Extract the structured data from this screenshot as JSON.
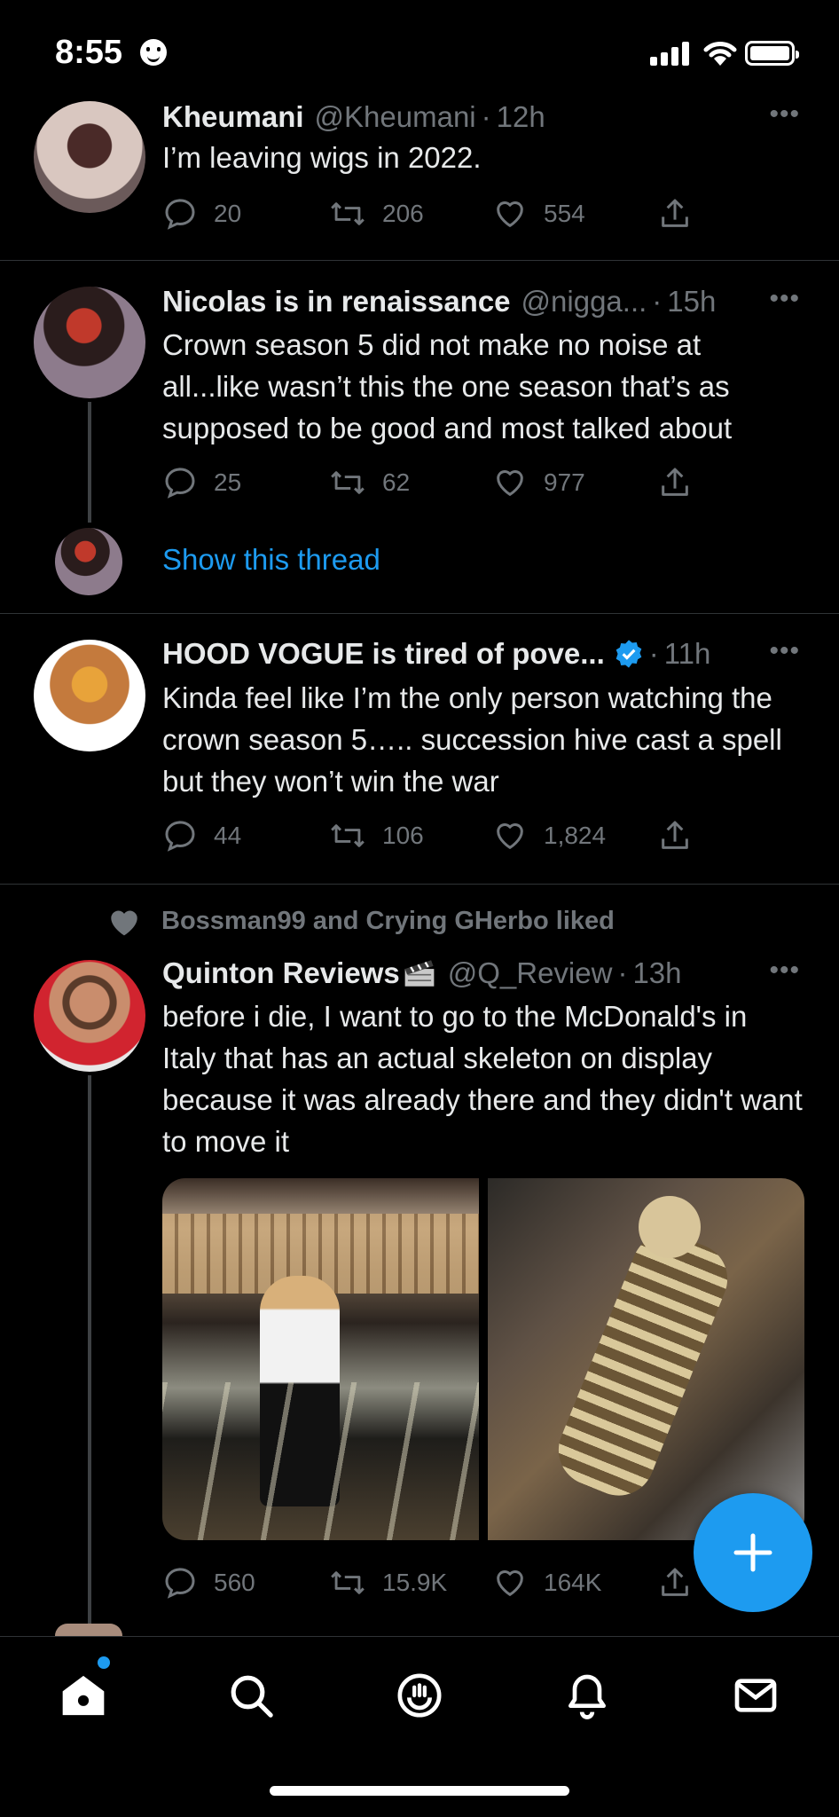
{
  "status": {
    "time": "8:55"
  },
  "tweets": [
    {
      "name": "Kheumani",
      "handle": "@Kheumani",
      "time": "12h",
      "text": "I’m leaving wigs in 2022.",
      "replies": "20",
      "retweets": "206",
      "likes": "554"
    },
    {
      "name": "Nicolas is in renaissance",
      "handle": "@nigga...",
      "time": "15h",
      "text": "Crown season 5 did not make no noise at all...like wasn’t this the one season that’s as supposed to be good and most talked about",
      "replies": "25",
      "retweets": "62",
      "likes": "977",
      "show_thread": "Show this thread"
    },
    {
      "name": "HOOD VOGUE is tired of pove...",
      "handle": "",
      "time": "11h",
      "text": "Kinda feel like I’m the only person watching the crown season 5….. succession hive cast a spell but they won’t win the war",
      "replies": "44",
      "retweets": "106",
      "likes": "1,824"
    },
    {
      "liked_by": "Bossman99 and Crying GHerbo liked",
      "name": "Quinton Reviews",
      "handle": "@Q_Review",
      "time": "13h",
      "text": "before i die, I want to go to the McDonald's in Italy that has an actual skeleton on display because it was already there and they didn't want to move it",
      "replies": "560",
      "retweets": "15.9K",
      "likes": "164K"
    }
  ],
  "icons": [
    "reply-icon",
    "retweet-icon",
    "like-icon",
    "share-icon",
    "more-icon",
    "verified-icon",
    "clapperboard-icon",
    "home-icon",
    "search-icon",
    "spaces-icon",
    "notifications-icon",
    "messages-icon",
    "compose-icon"
  ],
  "colors": {
    "accent": "#1d9bf0",
    "background": "#000000",
    "muted": "#71767b",
    "text": "#e7e9ea"
  }
}
